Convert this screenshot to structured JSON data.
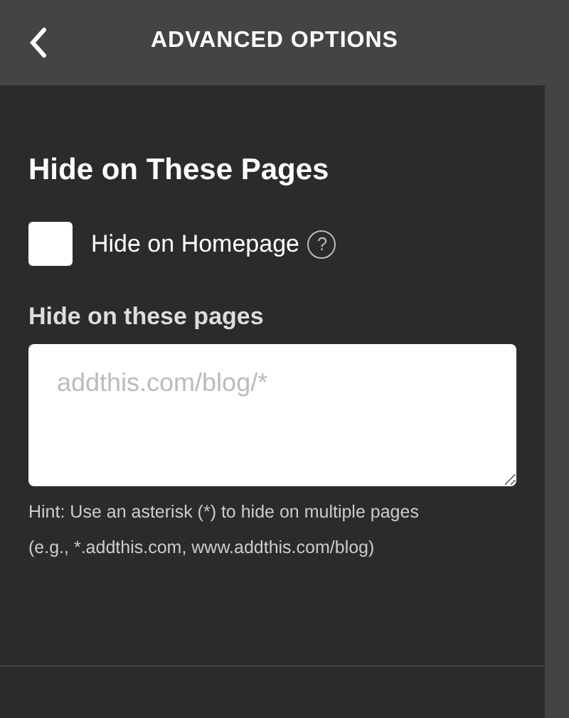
{
  "header": {
    "title": "ADVANCED OPTIONS"
  },
  "section": {
    "title": "Hide on These Pages"
  },
  "homepage_option": {
    "label": "Hide on Homepage",
    "checked": false,
    "help": "?"
  },
  "pages_field": {
    "label": "Hide on these pages",
    "placeholder": "addthis.com/blog/*"
  },
  "hint_lines": [
    "Hint: Use an asterisk (*) to hide on multiple pages",
    "(e.g., *.addthis.com, www.addthis.com/blog)"
  ]
}
